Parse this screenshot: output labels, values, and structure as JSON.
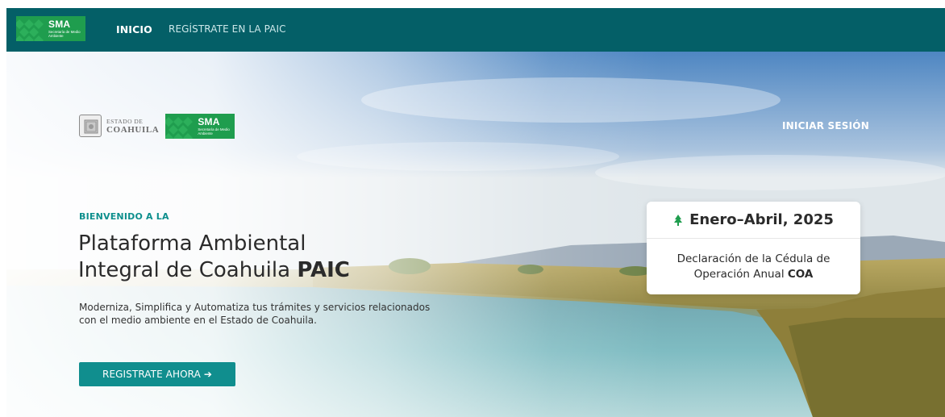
{
  "nav": {
    "logo_text": "SMA",
    "logo_sub": "Secretaría de Medio Ambiente",
    "links": [
      {
        "label": "INICIO"
      },
      {
        "label": "REGÍSTRATE EN LA PAIC"
      }
    ]
  },
  "hero": {
    "brand": {
      "estado_small": "ESTADO DE",
      "estado_big": "COAHUILA",
      "logo_text": "SMA",
      "logo_sub": "Secretaría de Medio Ambiente"
    },
    "login_label": "INICIAR SESIÓN",
    "welcome": "BIENVENIDO A LA",
    "title_line1": "Plataforma Ambiental",
    "title_line2": "Integral de Coahuila ",
    "title_bold": "PAIC",
    "description": "Moderniza, Simplifica y Automatiza tus trámites y servicios relacionados con el medio ambiente en el Estado de Coahuila.",
    "cta_label": "REGISTRATE AHORA ➔"
  },
  "card": {
    "icon": "tree-icon",
    "period": "Enero–Abril, 2025",
    "body_text": "Declaración de la Cédula de Operación Anual ",
    "body_bold": "COA"
  },
  "colors": {
    "navbar": "#045f67",
    "logo_green": "#1f9d4e",
    "accent": "#108e8e",
    "welcome": "#0e8f8d"
  }
}
